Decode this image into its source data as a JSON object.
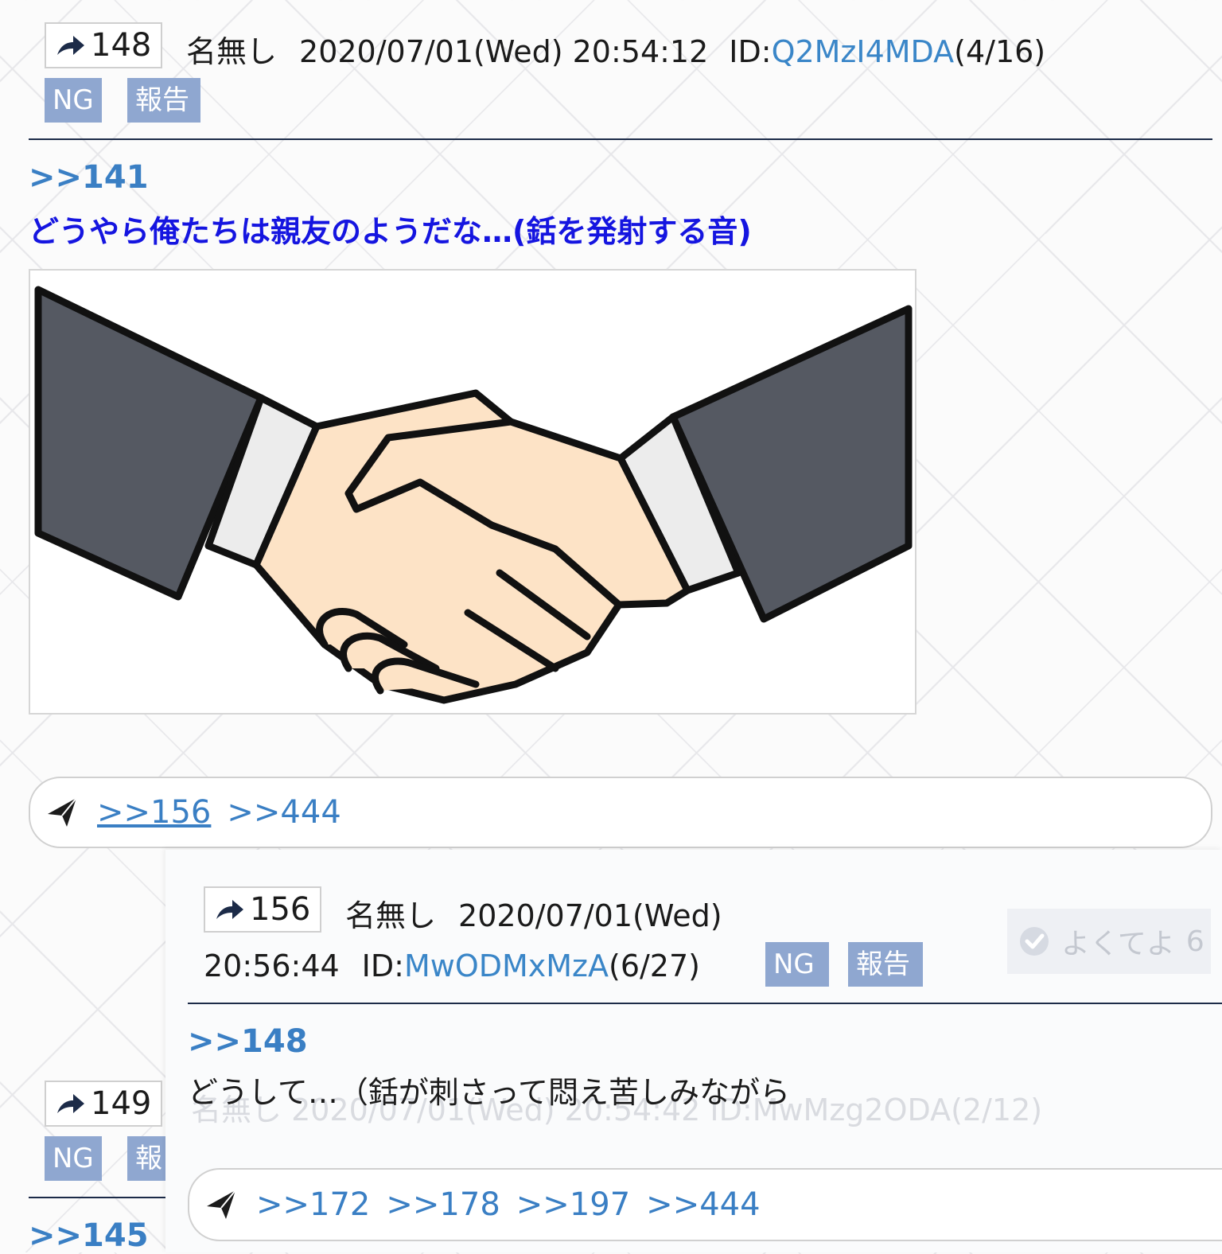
{
  "post148": {
    "number": "148",
    "name": "名無し",
    "date": "2020/07/01(Wed) 20:54:12",
    "id_prefix": "ID:",
    "id": "Q2MzI4MDA",
    "id_count": "(4/16)",
    "ng_label": "NG",
    "report_label": "報告",
    "anchor": ">>141",
    "body": "どうやら俺たちは親友のようだな…(銛を発射する音)",
    "image_desc": "handshake illustration",
    "replies": [
      ">>156",
      ">>444"
    ]
  },
  "post156": {
    "number": "156",
    "name": "名無し",
    "date": "2020/07/01(Wed)",
    "time": "20:56:44",
    "id_prefix": "ID:",
    "id": "MwODMxMzA",
    "id_count": "(6/27)",
    "ng_label": "NG",
    "report_label": "報告",
    "good_label": "よくてよ",
    "good_count": "6",
    "anchor": ">>148",
    "body": "どうして…（銛が刺さって悶え苦しみながら",
    "replies": [
      ">>172",
      ">>178",
      ">>197",
      ">>444"
    ]
  },
  "post149": {
    "number": "149",
    "ghost_meta": "名無し  2020/07/01(Wed) 20:54:42  ID:MwMzg2ODA(2/12)",
    "ng_label": "NG",
    "report_label": "報",
    "anchor": ">>145"
  },
  "colors": {
    "link": "#3a7fc4",
    "body_blue": "#1515e0",
    "button_bg": "#8fa7d0",
    "rule": "#1c2b48"
  }
}
